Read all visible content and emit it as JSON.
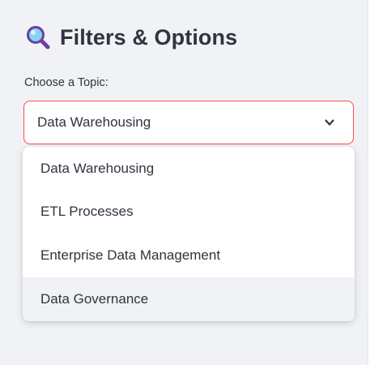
{
  "sidebar": {
    "header": {
      "icon": "magnifying-glass-icon",
      "title": "Filters & Options"
    },
    "topic_select": {
      "label": "Choose a Topic:",
      "selected": "Data Warehousing",
      "chevron_icon": "chevron-down-icon",
      "accent_color": "#ff4b4b",
      "options": [
        "Data Warehousing",
        "ETL Processes",
        "Enterprise Data Management",
        "Data Governance"
      ],
      "hovered_option": "Data Governance"
    }
  }
}
